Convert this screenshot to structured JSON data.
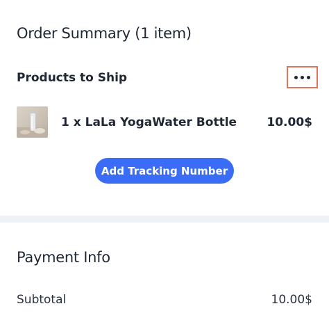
{
  "order_summary": {
    "title": "Order Summary (1 item)",
    "products_heading": "Products to Ship",
    "more_button_icon": "more-horizontal-icon",
    "more_button_highlight_color": "#e2725b",
    "products": [
      {
        "name": "1 x LaLa YogaWater Bottle",
        "price": "10.00$",
        "image": "water-bottle-thumbnail"
      }
    ],
    "tracking_button_label": "Add Tracking Number",
    "accent_color": "#3b6cf6"
  },
  "payment_info": {
    "title": "Payment Info",
    "subtotal_label": "Subtotal",
    "subtotal_value": "10.00$"
  }
}
